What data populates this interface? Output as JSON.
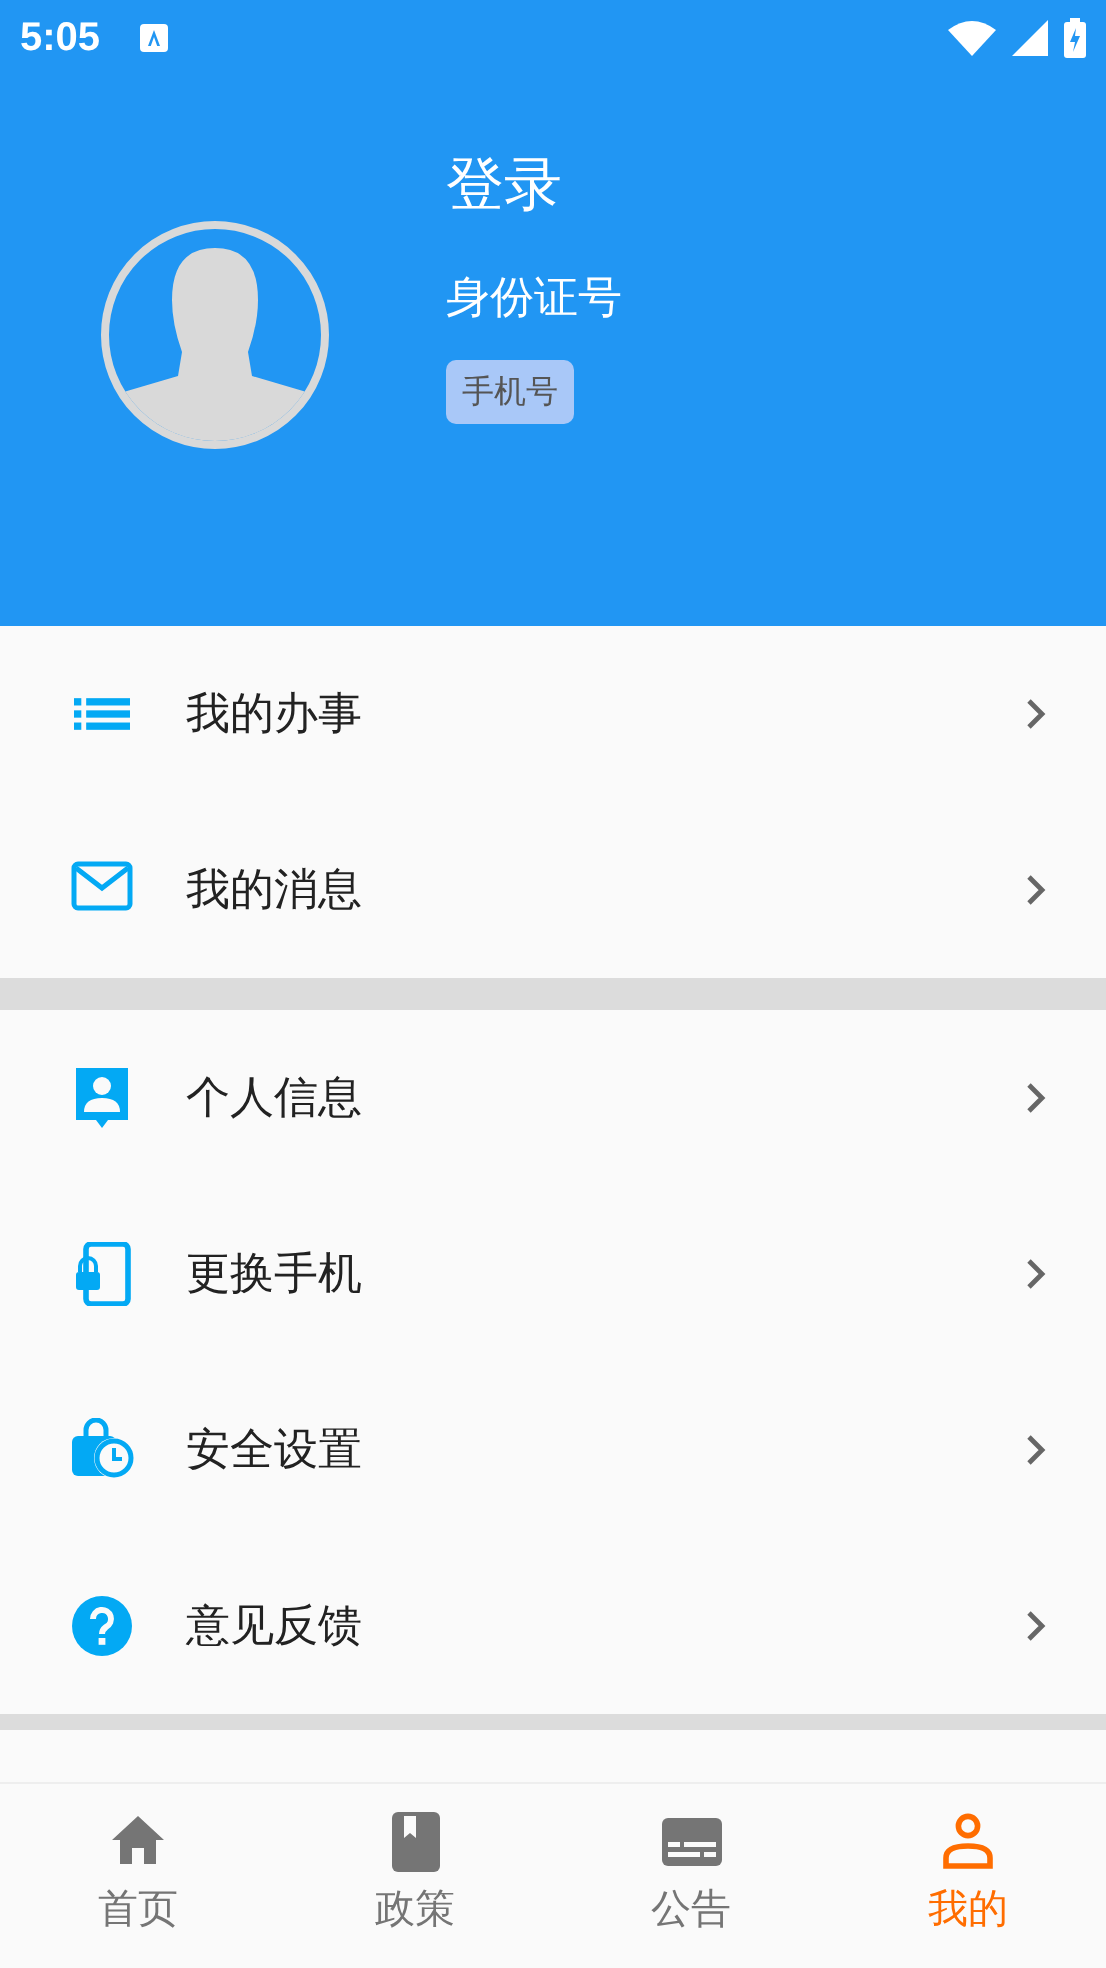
{
  "status_bar": {
    "time": "5:05"
  },
  "profile": {
    "title": "登录",
    "id_label": "身份证号",
    "phone_tag": "手机号"
  },
  "menu_groups": [
    {
      "items": [
        {
          "kind": "list",
          "label": "我的办事"
        },
        {
          "kind": "mail",
          "label": "我的消息"
        }
      ]
    },
    {
      "items": [
        {
          "kind": "person",
          "label": "个人信息"
        },
        {
          "kind": "phone",
          "label": "更换手机"
        },
        {
          "kind": "lockclock",
          "label": "安全设置"
        },
        {
          "kind": "help",
          "label": "意见反馈"
        }
      ]
    }
  ],
  "tabs": [
    {
      "kind": "home",
      "label": "首页",
      "selected": false
    },
    {
      "kind": "book",
      "label": "政策",
      "selected": false
    },
    {
      "kind": "notice",
      "label": "公告",
      "selected": false
    },
    {
      "kind": "user",
      "label": "我的",
      "selected": true
    }
  ]
}
